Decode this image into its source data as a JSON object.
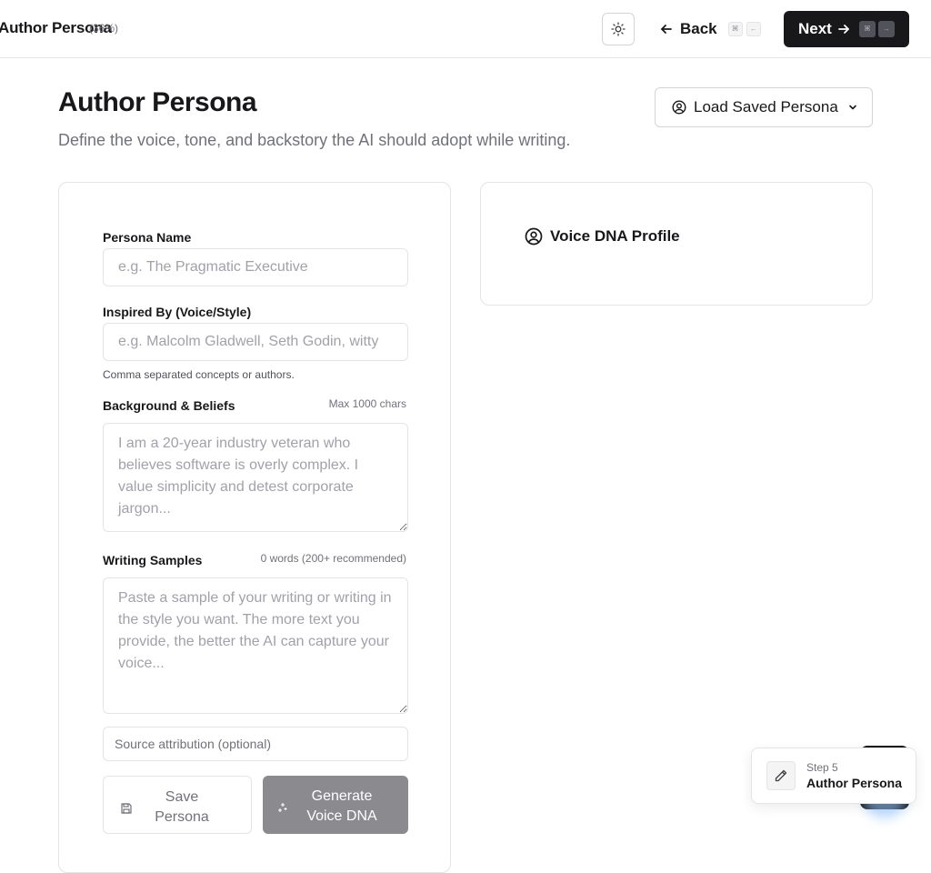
{
  "header": {
    "title": "Author Persona",
    "progress": "(36%)",
    "theme_toggle_icon": "sun-icon",
    "back_label": "Back",
    "back_keys": [
      "⌘",
      "←"
    ],
    "next_label": "Next",
    "next_keys": [
      "⌘",
      "→"
    ]
  },
  "page": {
    "title": "Author Persona",
    "subtitle": "Define the voice, tone, and backstory the AI should adopt while writing.",
    "load_button_label": "Load Saved Persona"
  },
  "form": {
    "persona_name": {
      "label": "Persona Name",
      "placeholder": "e.g. The Pragmatic Executive",
      "value": ""
    },
    "inspired_by": {
      "label": "Inspired By (Voice/Style)",
      "placeholder": "e.g. Malcolm Gladwell, Seth Godin, witty",
      "helper": "Comma separated concepts or authors.",
      "value": ""
    },
    "background": {
      "label": "Background & Beliefs",
      "hint": "Max 1000 chars",
      "placeholder": "I am a 20-year industry veteran who believes software is overly complex. I value simplicity and detest corporate jargon...",
      "value": ""
    },
    "writing_samples": {
      "label": "Writing Samples",
      "hint": "0 words (200+ recommended)",
      "placeholder": "Paste a sample of your writing or writing in the style you want. The more text you provide, the better the AI can capture your voice...",
      "value": ""
    },
    "source_attribution": {
      "placeholder": "Source attribution (optional)",
      "value": ""
    },
    "save_label": "Save Persona",
    "generate_label": "Generate Voice DNA"
  },
  "voice_panel": {
    "title": "Voice DNA Profile"
  },
  "toast": {
    "step": "Step 5",
    "name": "Author Persona"
  },
  "colors": {
    "primary": "#18181b",
    "muted_text": "#71717a",
    "border": "#e4e4e7",
    "disabled_button": "#8a8a8f"
  }
}
